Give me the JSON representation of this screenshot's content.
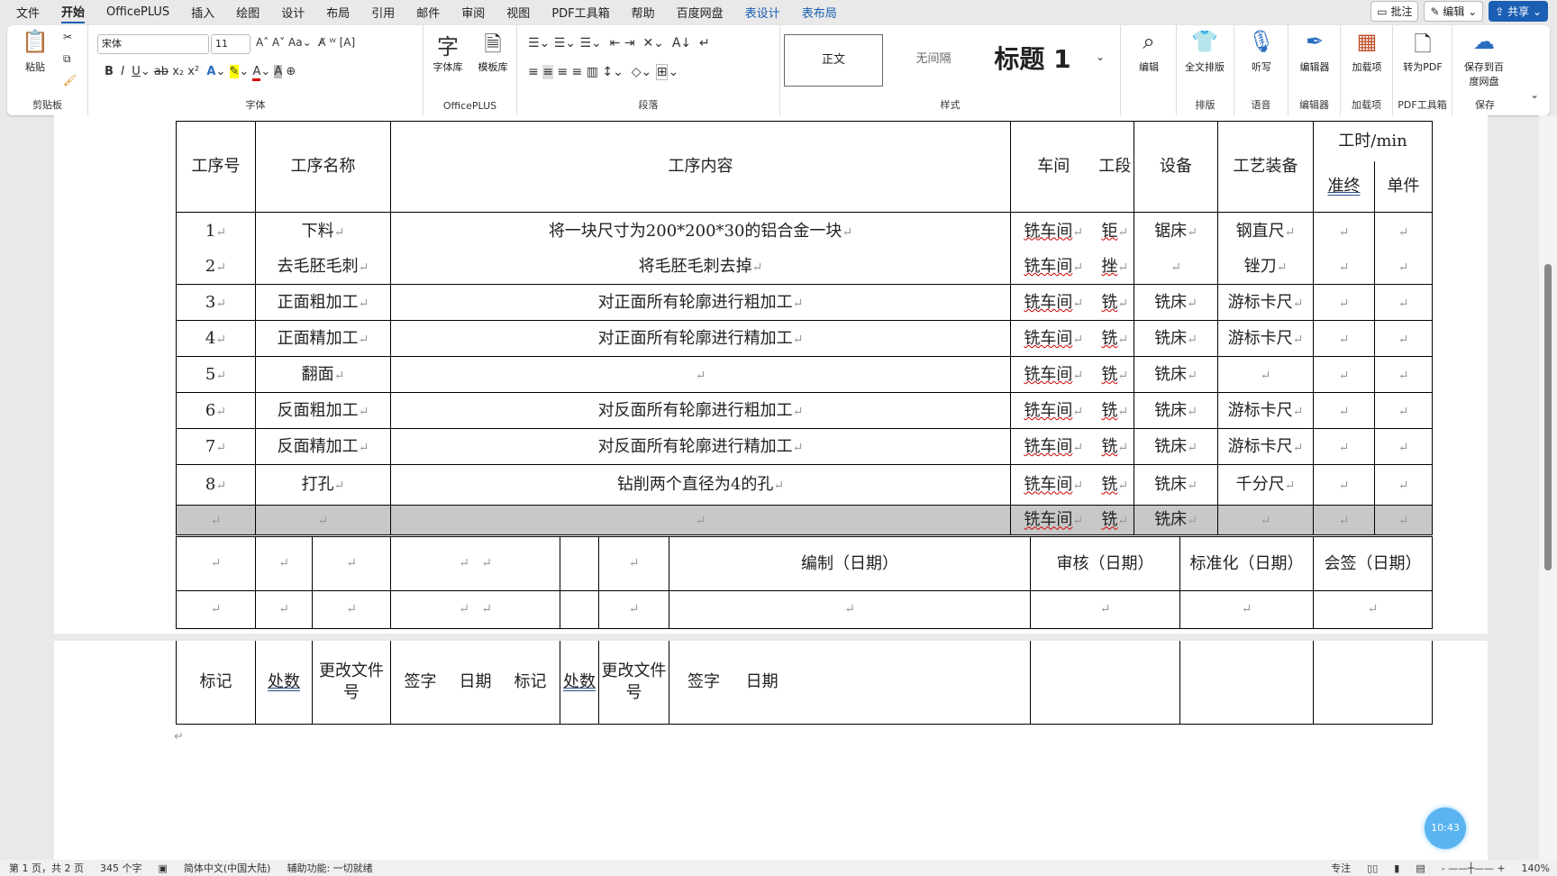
{
  "tabs": [
    "文件",
    "开始",
    "OfficePLUS",
    "插入",
    "绘图",
    "设计",
    "布局",
    "引用",
    "邮件",
    "审阅",
    "视图",
    "PDF工具箱",
    "帮助",
    "百度网盘",
    "表设计",
    "表布局"
  ],
  "top_buttons": {
    "comment": "批注",
    "edit": "编辑",
    "share": "共享"
  },
  "ribbon": {
    "clipboard": {
      "paste": "粘贴",
      "label": "剪贴板"
    },
    "font": {
      "name": "宋体",
      "size": "11",
      "label": "字体"
    },
    "officeplus": {
      "font_lib": "字体库",
      "template_lib": "模板库",
      "label": "OfficePLUS"
    },
    "paragraph": {
      "label": "段落"
    },
    "styles": {
      "items": [
        "正文",
        "无间隔",
        "标题 1"
      ],
      "label": "样式"
    },
    "edit": "编辑",
    "layout": {
      "btn": "全文排版",
      "label": "排版"
    },
    "voice": {
      "btn": "听写",
      "label": "语音"
    },
    "editor": {
      "btn": "编辑器",
      "label": "编辑器"
    },
    "addins": {
      "btn": "加载项",
      "label": "加载项"
    },
    "pdf": {
      "btn": "转为PDF",
      "label": "PDF工具箱"
    },
    "save": {
      "btn": "保存到百度网盘",
      "label": "保存"
    }
  },
  "table": {
    "headers": {
      "no": "工序号",
      "name": "工序名称",
      "content": "工序内容",
      "workshop": "车间",
      "section": "工段",
      "equipment": "设备",
      "tooling": "工艺装备",
      "time": "工时/min",
      "prep": "准终",
      "unit": "单件"
    },
    "rows": [
      {
        "no": "1",
        "name": "下料",
        "content": "将一块尺寸为200*200*30的铝合金一块",
        "workshop": "铣车间",
        "section": "钜",
        "equipment": "锯床",
        "tooling": "钢直尺"
      },
      {
        "no": "2",
        "name": "去毛胚毛刺",
        "content": "将毛胚毛刺去掉",
        "workshop": "铣车间",
        "section": "挫",
        "equipment": "",
        "tooling": "锉刀"
      },
      {
        "no": "3",
        "name": "正面粗加工",
        "content": "对正面所有轮廓进行粗加工",
        "workshop": "铣车间",
        "section": "铣",
        "equipment": "铣床",
        "tooling": "游标卡尺"
      },
      {
        "no": "4",
        "name": "正面精加工",
        "content": "对正面所有轮廓进行精加工",
        "workshop": "铣车间",
        "section": "铣",
        "equipment": "铣床",
        "tooling": "游标卡尺"
      },
      {
        "no": "5",
        "name": "翻面",
        "content": "",
        "workshop": "铣车间",
        "section": "铣",
        "equipment": "铣床",
        "tooling": ""
      },
      {
        "no": "6",
        "name": "反面粗加工",
        "content": "对反面所有轮廓进行粗加工",
        "workshop": "铣车间",
        "section": "铣",
        "equipment": "铣床",
        "tooling": "游标卡尺"
      },
      {
        "no": "7",
        "name": "反面精加工",
        "content": "对反面所有轮廓进行精加工",
        "workshop": "铣车间",
        "section": "铣",
        "equipment": "铣床",
        "tooling": "游标卡尺"
      },
      {
        "no": "8",
        "name": "打孔",
        "content": "钻削两个直径为4的孔",
        "workshop": "铣车间",
        "section": "铣",
        "equipment": "铣床",
        "tooling": "千分尺"
      },
      {
        "no": "",
        "name": "",
        "content": "",
        "workshop": "铣车间",
        "section": "铣",
        "equipment": "铣床",
        "tooling": ""
      }
    ]
  },
  "footer": {
    "compile": "编制（日期）",
    "review": "审核（日期）",
    "standard": "标准化（日期）",
    "countersign": "会签（日期）"
  },
  "page2": {
    "mark": "标记",
    "count": "处数",
    "change_doc": "更改文件号",
    "sign": "签字",
    "date": "日期"
  },
  "clock": "10:43",
  "status": {
    "page": "第 1 页，共 2 页",
    "words": "345 个字",
    "lang": "简体中文(中国大陆)",
    "accessibility": "辅助功能: 一切就绪",
    "focus": "专注",
    "zoom": "140%"
  }
}
